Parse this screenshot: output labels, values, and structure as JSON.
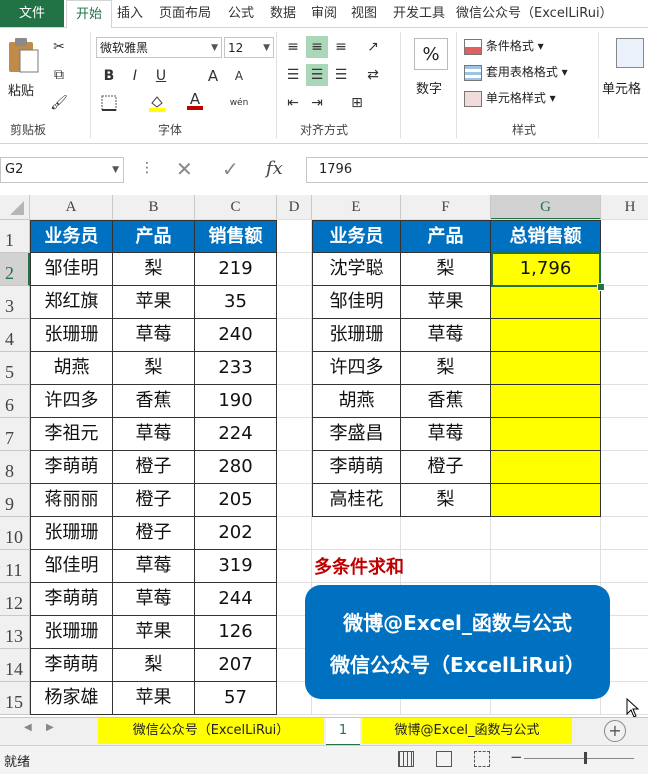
{
  "ribbon_tabs": [
    "文件",
    "开始",
    "插入",
    "页面布局",
    "公式",
    "数据",
    "审阅",
    "视图",
    "开发工具",
    "微信公众号（ExcelLiRui）"
  ],
  "ribbon": {
    "clipboard": {
      "paste_label": "粘贴",
      "group_label": "剪贴板"
    },
    "font": {
      "font_name": "微软雅黑",
      "font_size": "12",
      "bold": "B",
      "italic": "I",
      "underline": "U",
      "grow": "A",
      "shrink": "A",
      "font_color_letter": "A",
      "wen": "wén",
      "group_label": "字体"
    },
    "alignment": {
      "group_label": "对齐方式"
    },
    "number": {
      "percent": "%",
      "label": "数字"
    },
    "styles": {
      "conditional": "条件格式",
      "table": "套用表格格式",
      "cell_styles": "单元格样式",
      "group_label": "样式"
    },
    "cells": {
      "label": "单元格"
    }
  },
  "formula_bar": {
    "name_box": "G2",
    "fx": "fx",
    "value": "1796"
  },
  "columns": [
    "A",
    "B",
    "C",
    "D",
    "E",
    "F",
    "G",
    "H"
  ],
  "rows": [
    "1",
    "2",
    "3",
    "4",
    "5",
    "6",
    "7",
    "8",
    "9",
    "10",
    "11",
    "12",
    "13",
    "14",
    "15"
  ],
  "left_table": {
    "headers": [
      "业务员",
      "产品",
      "销售额"
    ],
    "rows": [
      [
        "邹佳明",
        "梨",
        "219"
      ],
      [
        "郑红旗",
        "苹果",
        "35"
      ],
      [
        "张珊珊",
        "草莓",
        "240"
      ],
      [
        "胡燕",
        "梨",
        "233"
      ],
      [
        "许四多",
        "香蕉",
        "190"
      ],
      [
        "李祖元",
        "草莓",
        "224"
      ],
      [
        "李萌萌",
        "橙子",
        "280"
      ],
      [
        "蒋丽丽",
        "橙子",
        "205"
      ],
      [
        "张珊珊",
        "橙子",
        "202"
      ],
      [
        "邹佳明",
        "草莓",
        "319"
      ],
      [
        "李萌萌",
        "草莓",
        "244"
      ],
      [
        "张珊珊",
        "苹果",
        "126"
      ],
      [
        "李萌萌",
        "梨",
        "207"
      ],
      [
        "杨家雄",
        "苹果",
        "57"
      ]
    ]
  },
  "right_table": {
    "headers": [
      "业务员",
      "产品",
      "总销售额"
    ],
    "rows": [
      [
        "沈学聪",
        "梨",
        "1,796"
      ],
      [
        "邹佳明",
        "苹果",
        ""
      ],
      [
        "张珊珊",
        "草莓",
        ""
      ],
      [
        "许四多",
        "梨",
        ""
      ],
      [
        "胡燕",
        "香蕉",
        ""
      ],
      [
        "李盛昌",
        "草莓",
        ""
      ],
      [
        "李萌萌",
        "橙子",
        ""
      ],
      [
        "高桂花",
        "梨",
        ""
      ]
    ]
  },
  "caption": "多条件求和",
  "banner": {
    "line1": "微博@Excel_函数与公式",
    "line2": "微信公众号（ExcelLiRui）"
  },
  "sheet_tabs": [
    "微信公众号（ExcelLiRui）",
    "1",
    "微博@Excel_函数与公式"
  ],
  "status": {
    "ready": "就绪"
  },
  "colors": {
    "excel_green": "#217346",
    "header_blue": "#0070c0",
    "highlight_yellow": "#ffff00",
    "caption_red": "#c00000",
    "banner_blue": "#0070c0"
  }
}
